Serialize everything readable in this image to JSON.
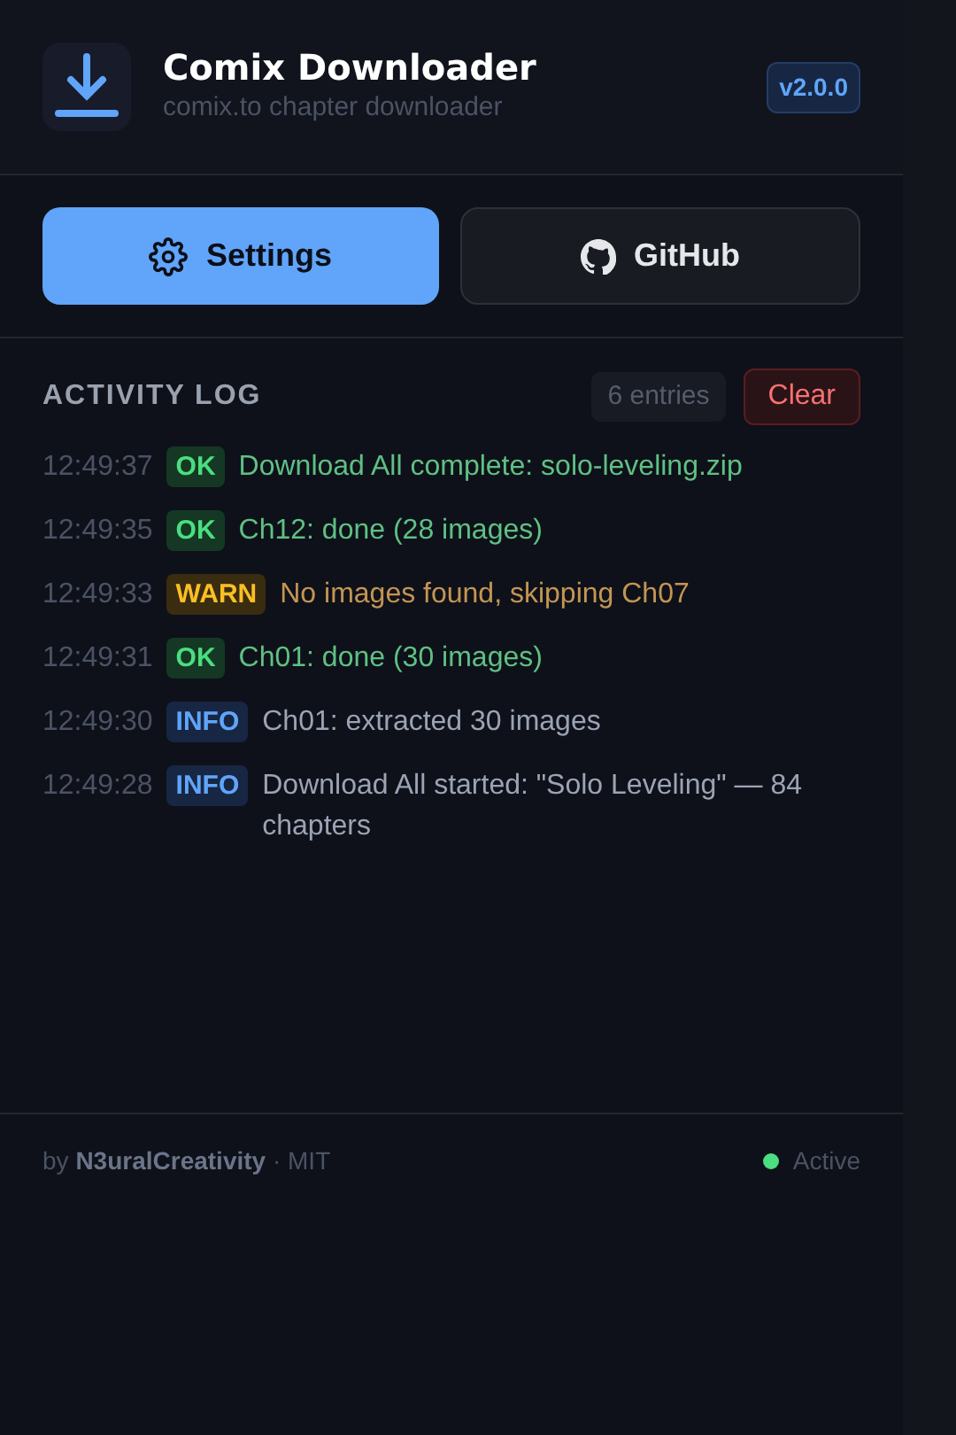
{
  "header": {
    "title": "Comix Downloader",
    "subtitle": "comix.to chapter downloader",
    "version": "v2.0.0"
  },
  "buttons": [
    {
      "label": "Settings",
      "kind": "primary"
    },
    {
      "label": "GitHub",
      "kind": "github"
    }
  ],
  "log": {
    "heading": "ACTIVITY LOG",
    "count": "6 entries",
    "clear": "Clear",
    "entries": [
      {
        "time": "12:49:37",
        "level": "OK",
        "kind": "ok",
        "message": "Download All complete: solo-leveling.zip"
      },
      {
        "time": "12:49:35",
        "level": "OK",
        "kind": "ok",
        "message": "Ch12: done (28 images)"
      },
      {
        "time": "12:49:33",
        "level": "WARN",
        "kind": "warn",
        "message": "No images found, skipping Ch07"
      },
      {
        "time": "12:49:31",
        "level": "OK",
        "kind": "ok",
        "message": "Ch01: done (30 images)"
      },
      {
        "time": "12:49:30",
        "level": "INFO",
        "kind": "info",
        "message": "Ch01: extracted 30 images"
      },
      {
        "time": "12:49:28",
        "level": "INFO",
        "kind": "info",
        "message": "Download All started: \"Solo Leveling\" — 84 chapters"
      }
    ]
  },
  "footer": {
    "credit": "by **N3uralCreativity** · MIT",
    "status": {
      "label": "Active",
      "color": "#4ade80"
    }
  }
}
